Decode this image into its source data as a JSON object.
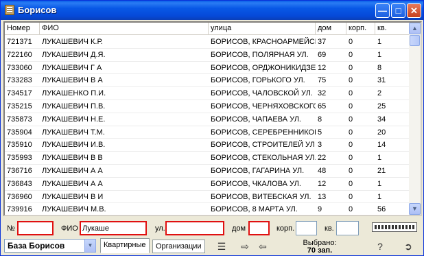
{
  "window": {
    "title": "Борисов"
  },
  "columns": {
    "number": "Номер",
    "fio": "ФИО",
    "street": "улица",
    "house": "дом",
    "korp": "корп.",
    "kv": "кв."
  },
  "rows": [
    [
      "721371",
      "ЛУКАШЕВИЧ К.Р.",
      "БОРИСОВ,  КРАСНОАРМЕЙСК",
      "37",
      "0",
      "1"
    ],
    [
      "722160",
      "ЛУКАШЕВИЧ Д.Я.",
      "БОРИСОВ,  ПОЛЯРНАЯ УЛ.",
      "69",
      "0",
      "1"
    ],
    [
      "733060",
      "ЛУКАШЕВИЧ Г А",
      "БОРИСОВ,  ОРДЖОНИКИДЗЕ",
      "12",
      "0",
      "8"
    ],
    [
      "733283",
      "ЛУКАШЕВИЧ  В А",
      "БОРИСОВ,  ГОРЬКОГО УЛ.",
      "75",
      "0",
      "31"
    ],
    [
      "734517",
      "ЛУКАШЕНКО П.И.",
      "БОРИСОВ,  ЧАЛОВСКОЙ УЛ.",
      "32",
      "0",
      "2"
    ],
    [
      "735215",
      "ЛУКАШЕВИЧ П.В.",
      "БОРИСОВ,  ЧЕРНЯХОВСКОГО",
      "65",
      "0",
      "25"
    ],
    [
      "735873",
      "ЛУКАШЕВИЧ Н.Е.",
      "БОРИСОВ,  ЧАПАЕВА УЛ.",
      "8",
      "0",
      "34"
    ],
    [
      "735904",
      "ЛУКАШЕВИЧ Т.М.",
      "БОРИСОВ,  СЕРЕБРЕННИКОВА",
      "5",
      "0",
      "20"
    ],
    [
      "735910",
      "ЛУКАШЕВИЧ И.В.",
      "БОРИСОВ,  СТРОИТЕЛЕЙ УЛ",
      "3",
      "0",
      "14"
    ],
    [
      "735993",
      "ЛУКАШЕВИЧ В В",
      "БОРИСОВ,  СТЕКОЛЬНАЯ УЛ.",
      "22",
      "0",
      "1"
    ],
    [
      "736716",
      "ЛУКАШЕВИЧ А А",
      "БОРИСОВ,  ГАГАРИНА УЛ.",
      "48",
      "0",
      "21"
    ],
    [
      "736843",
      "ЛУКАШЕВИЧ А А",
      "БОРИСОВ,  ЧКАЛОВА УЛ.",
      "12",
      "0",
      "1"
    ],
    [
      "736960",
      "ЛУКАШЕВИЧ В И",
      "БОРИСОВ,  ВИТЕБСКАЯ УЛ.",
      "13",
      "0",
      "1"
    ],
    [
      "739916",
      "ЛУКАШЕВИЧ М.В.",
      "БОРИСОВ,  8 МАРТА УЛ.",
      "9",
      "0",
      "56"
    ]
  ],
  "filter": {
    "number_label": "№",
    "number_value": "",
    "fio_label": "ФИО",
    "fio_value": "Лукаше",
    "street_label": "ул.",
    "street_value": "",
    "house_label": "дом",
    "house_value": "",
    "korp_label": "корп.",
    "korp_value": "",
    "kv_label": "кв.",
    "kv_value": ""
  },
  "bottom": {
    "database": "База Борисов",
    "tabs": [
      "Квартирные",
      "Организации"
    ],
    "selected_label": "Выбрано:",
    "selected_value": "70 зап."
  },
  "icons": {
    "list": "list-icon",
    "export": "export-icon",
    "import": "import-icon",
    "help": "help-icon",
    "exit": "exit-door-icon"
  }
}
